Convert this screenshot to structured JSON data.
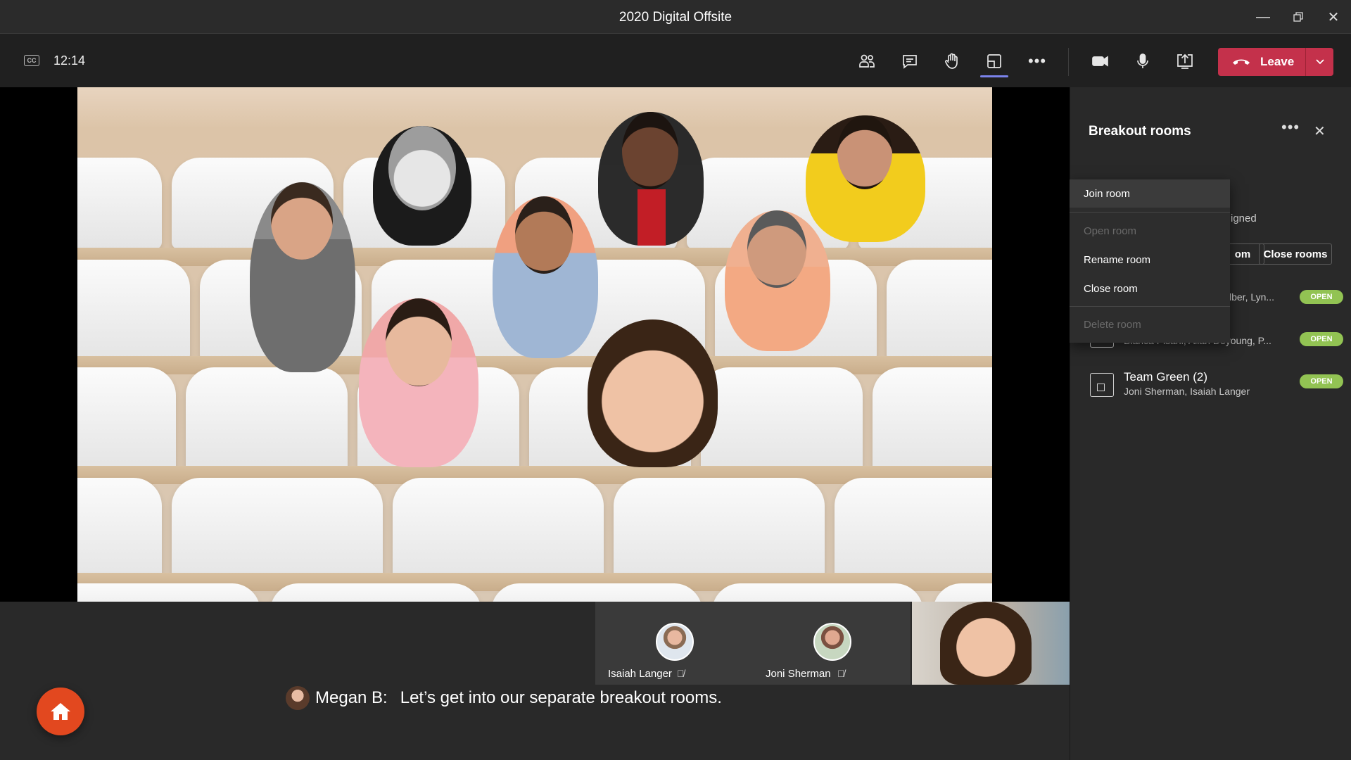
{
  "window": {
    "title": "2020 Digital Offsite",
    "controls": [
      "minimize",
      "maximize",
      "close"
    ]
  },
  "toolbar": {
    "elapsed": "12:14",
    "buttons": [
      "people-icon",
      "chat-icon",
      "raise-hand-icon",
      "breakout-rooms-icon",
      "more-icon"
    ],
    "active": "breakout-rooms-icon",
    "media": [
      "camera-icon",
      "microphone-icon",
      "share-screen-icon"
    ],
    "leave_label": "Leave",
    "leave_color": "#c4314b"
  },
  "participants": [
    {
      "name": "Isaiah Langer",
      "muted": true
    },
    {
      "name": "Joni Sherman",
      "muted": true
    }
  ],
  "caption": {
    "speaker": "Megan B:",
    "text": "Let’s get into our separate breakout rooms."
  },
  "panel": {
    "title": "Breakout rooms",
    "assigned_fragment": "igned",
    "room_button_fragment": "om",
    "close_rooms_label": "Close rooms",
    "rooms": [
      {
        "name": "",
        "members": "lber, Lyn...",
        "status": "OPEN"
      },
      {
        "name": "",
        "members": "Bianca Pisani, Allan Deyoung, P...",
        "status": "OPEN"
      },
      {
        "name": "Team Green (2)",
        "members": "Joni Sherman, Isaiah Langer",
        "status": "OPEN"
      }
    ],
    "status_color": "#92c353"
  },
  "context_menu": {
    "items": [
      {
        "label": "Join room",
        "enabled": true
      },
      {
        "label": "Open room",
        "enabled": false
      },
      {
        "label": "Rename room",
        "enabled": true
      },
      {
        "label": "Close room",
        "enabled": true
      },
      {
        "label": "Delete room",
        "enabled": false
      }
    ]
  }
}
